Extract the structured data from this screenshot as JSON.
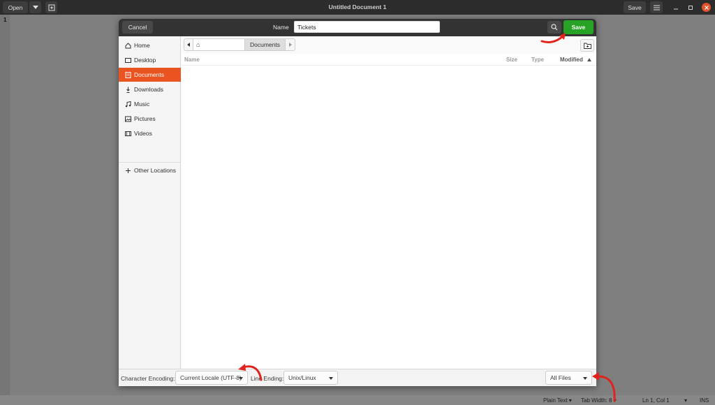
{
  "window": {
    "title": "Untitled Document 1",
    "open_label": "Open",
    "save_label": "Save"
  },
  "editor": {
    "line_number": "1"
  },
  "statusbar": {
    "syntax": "Plain Text",
    "tab_width": "Tab Width: 8",
    "position": "Ln 1, Col 1",
    "mode": "INS"
  },
  "dialog": {
    "cancel_label": "Cancel",
    "name_label": "Name",
    "filename": "Tickets",
    "save_label": "Save",
    "sidebar": {
      "items": [
        {
          "label": "Home",
          "icon": "home-icon"
        },
        {
          "label": "Desktop",
          "icon": "desktop-icon"
        },
        {
          "label": "Documents",
          "icon": "documents-icon",
          "active": true
        },
        {
          "label": "Downloads",
          "icon": "downloads-icon"
        },
        {
          "label": "Music",
          "icon": "music-icon"
        },
        {
          "label": "Pictures",
          "icon": "pictures-icon"
        },
        {
          "label": "Videos",
          "icon": "videos-icon"
        }
      ],
      "other_locations": "Other Locations"
    },
    "pathbar": {
      "current": "Documents"
    },
    "columns": {
      "name": "Name",
      "size": "Size",
      "type": "Type",
      "modified": "Modified"
    },
    "footer": {
      "encoding_label": "Character Encoding:",
      "encoding_value": "Current Locale (UTF-8)",
      "line_ending_label": "Line Ending:",
      "line_ending_value": "Unix/Linux",
      "filter_value": "All Files"
    }
  },
  "colors": {
    "accent": "#e95420",
    "save_green": "#26a325",
    "annotation_red": "#e0231c"
  }
}
